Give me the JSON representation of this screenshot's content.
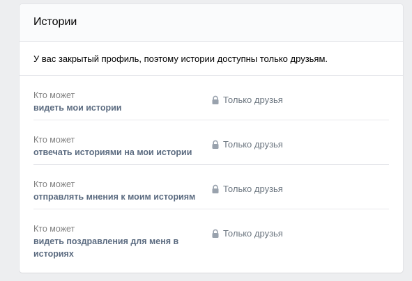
{
  "stories": {
    "title": "Истории",
    "notice": "У вас закрытый профиль, поэтому истории доступны только друзьям.",
    "rows": [
      {
        "sub": "Кто может",
        "main": "видеть мои истории",
        "value": "Только друзья",
        "icon": "lock-icon"
      },
      {
        "sub": "Кто может",
        "main": "отвечать историями на мои истории",
        "value": "Только друзья",
        "icon": "lock-icon"
      },
      {
        "sub": "Кто может",
        "main": "отправлять мнения к моим историям",
        "value": "Только друзья",
        "icon": "lock-icon"
      },
      {
        "sub": "Кто может",
        "main": "видеть поздравления для меня в историях",
        "value": "Только друзья",
        "icon": "lock-icon"
      }
    ]
  },
  "colors": {
    "background": "#edeef0",
    "panel": "#ffffff",
    "header": "#fafbfc",
    "divider": "#e7e8ec",
    "muted_text": "#828282",
    "label_text": "#5b6b80",
    "value_text": "#6c7680"
  }
}
